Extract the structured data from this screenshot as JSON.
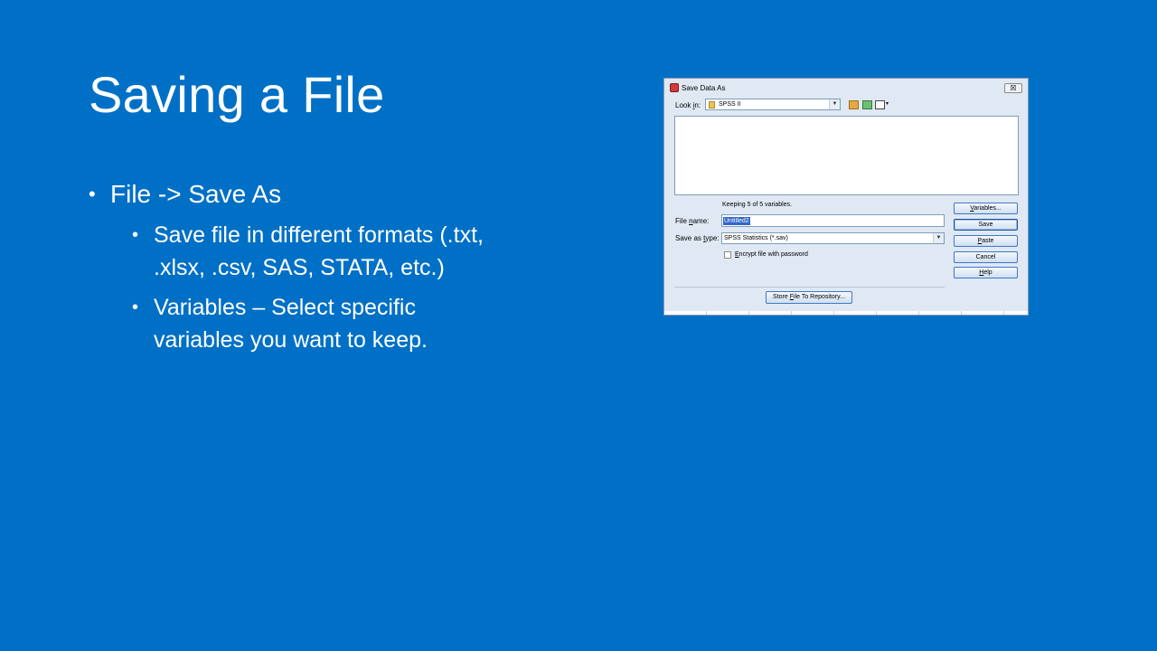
{
  "slide": {
    "title": "Saving a File",
    "bullets": [
      {
        "text": "File -> Save As",
        "children": [
          {
            "line1": "Save file in different formats (.txt,",
            "line2": ".xlsx, .csv, SAS, STATA, etc.)"
          },
          {
            "line1": "Variables – Select specific",
            "line2": "variables you want to keep."
          }
        ]
      }
    ],
    "bullet_glyph": "•",
    "background_color": "#0070c6"
  },
  "dialog": {
    "title": "Save Data As",
    "close_glyph": "☒",
    "look_in": {
      "label_pre": "Look ",
      "label_u": "i",
      "label_post": "n:",
      "value": "SPSS II",
      "arrow": "▼"
    },
    "toolbar_icons": [
      "up-folder-icon",
      "new-folder-icon",
      "view-menu-icon"
    ],
    "toolbar_arrow": "▾",
    "keeping_text": "Keeping 5 of 5 variables.",
    "file_name": {
      "label_pre": "File ",
      "label_u": "n",
      "label_post": "ame:",
      "value": "Untitled2"
    },
    "save_as_type": {
      "label_pre": "Save as ",
      "label_u": "t",
      "label_post": "ype:",
      "value": "SPSS Statistics (*.sav)",
      "arrow": "▼"
    },
    "encrypt": {
      "label_u": "E",
      "label_post": "ncrypt file with password",
      "checked": false
    },
    "buttons": {
      "variables": {
        "u": "V",
        "rest": "ariables..."
      },
      "save": {
        "text": "Save"
      },
      "paste": {
        "u": "P",
        "rest": "aste"
      },
      "cancel": {
        "text": "Cancel"
      },
      "help": {
        "u": "H",
        "rest": "elp"
      }
    },
    "repository_button": {
      "pre": "Store ",
      "u": "F",
      "post": "ile To Repository..."
    }
  }
}
